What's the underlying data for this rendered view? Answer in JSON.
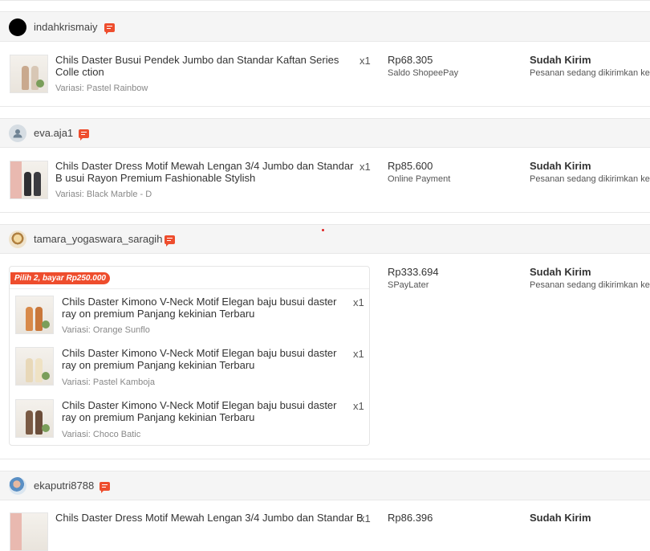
{
  "orders": [
    {
      "username": "indahkrismaiy",
      "avatar_icon": "black-circle-avatar",
      "product": "Chils Daster Busui Pendek Jumbo dan Standar Kaftan Series Colle ction",
      "quantity": "x1",
      "variant": "Variasi: Pastel Rainbow",
      "price": "Rp68.305",
      "payment": "Saldo ShopeePay",
      "status": "Sudah Kirim",
      "status_desc": "Pesanan sedang dikirimkan ke I"
    },
    {
      "username": "eva.aja1",
      "avatar_icon": "default-user-avatar",
      "product": "Chils Daster Dress Motif Mewah Lengan 3/4 Jumbo dan Standar B usui Rayon Premium Fashionable Stylish",
      "quantity": "x1",
      "variant": "Variasi: Black Marble - D",
      "price": "Rp85.600",
      "payment": "Online Payment",
      "status": "Sudah Kirim",
      "status_desc": "Pesanan sedang dikirimkan ke I"
    },
    {
      "username": "tamara_yogaswara_saragih",
      "avatar_icon": "photo-avatar",
      "promo_label": "Pilih 2, bayar Rp250.000",
      "items": [
        {
          "product": "Chils Daster Kimono V-Neck Motif Elegan baju busui daster ray on premium Panjang kekinian Terbaru",
          "quantity": "x1",
          "variant": "Variasi: Orange Sunflo"
        },
        {
          "product": "Chils Daster Kimono V-Neck Motif Elegan baju busui daster ray on premium Panjang kekinian Terbaru",
          "quantity": "x1",
          "variant": "Variasi: Pastel Kamboja"
        },
        {
          "product": "Chils Daster Kimono V-Neck Motif Elegan baju busui daster ray on premium Panjang kekinian Terbaru",
          "quantity": "x1",
          "variant": "Variasi: Choco Batic"
        }
      ],
      "price": "Rp333.694",
      "payment": "SPayLater",
      "status": "Sudah Kirim",
      "status_desc": "Pesanan sedang dikirimkan ke I"
    },
    {
      "username": "ekaputri8788",
      "avatar_icon": "photo-avatar",
      "product": "Chils Daster Dress Motif Mewah Lengan 3/4 Jumbo dan Standar B",
      "quantity": "x1",
      "price": "Rp86.396",
      "status": "Sudah Kirim"
    }
  ],
  "colors": {
    "accent": "#ee4d2d",
    "header_bg": "#f5f5f5",
    "border": "#e8e8e8"
  }
}
